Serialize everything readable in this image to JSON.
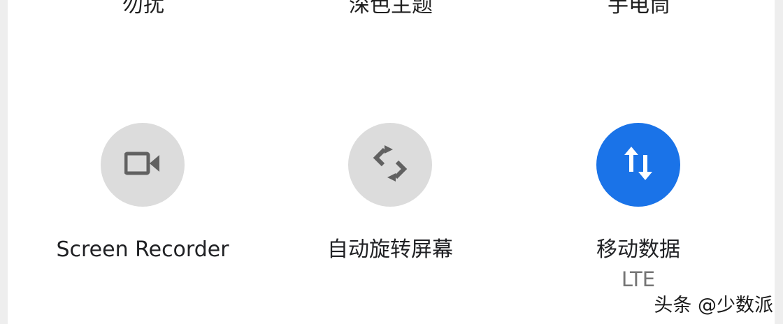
{
  "top_row": {
    "labels": [
      "勿扰",
      "深色主题",
      "手电筒"
    ]
  },
  "tiles": [
    {
      "label": "Screen Recorder",
      "icon": "video-camera-icon",
      "state": "off"
    },
    {
      "label": "自动旋转屏幕",
      "icon": "auto-rotate-icon",
      "state": "off"
    },
    {
      "label": "移动数据",
      "sublabel": "LTE",
      "icon": "mobile-data-arrows-icon",
      "state": "on"
    }
  ],
  "colors": {
    "tile_off": "#dcdcdc",
    "tile_on": "#1a73e8",
    "icon_off": "#616161",
    "icon_on": "#ffffff"
  },
  "watermark": "头条 @少数派"
}
